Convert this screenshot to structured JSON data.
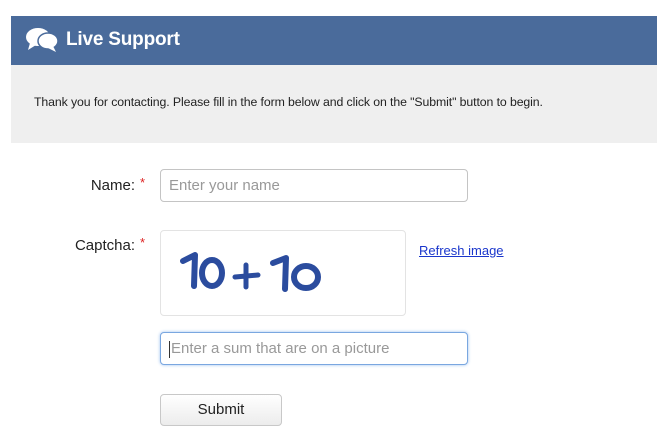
{
  "header": {
    "title": "Live Support",
    "icon": "chat-bubbles-icon",
    "background": "#4a6b9b"
  },
  "intro": {
    "message": "Thank you for contacting. Please fill in the form below and click on the \"Submit\" button to begin."
  },
  "form": {
    "name": {
      "label": "Name:",
      "required_mark": "*",
      "placeholder": "Enter your name",
      "value": ""
    },
    "captcha": {
      "label": "Captcha:",
      "required_mark": "*",
      "image_text": "10 + 10",
      "refresh_label": "Refresh image",
      "placeholder": "Enter a sum that are on a picture",
      "value": ""
    },
    "submit_label": "Submit"
  },
  "colors": {
    "required": "#dd2222",
    "link": "#1a36cc",
    "captcha_ink": "#2b4c9e"
  }
}
